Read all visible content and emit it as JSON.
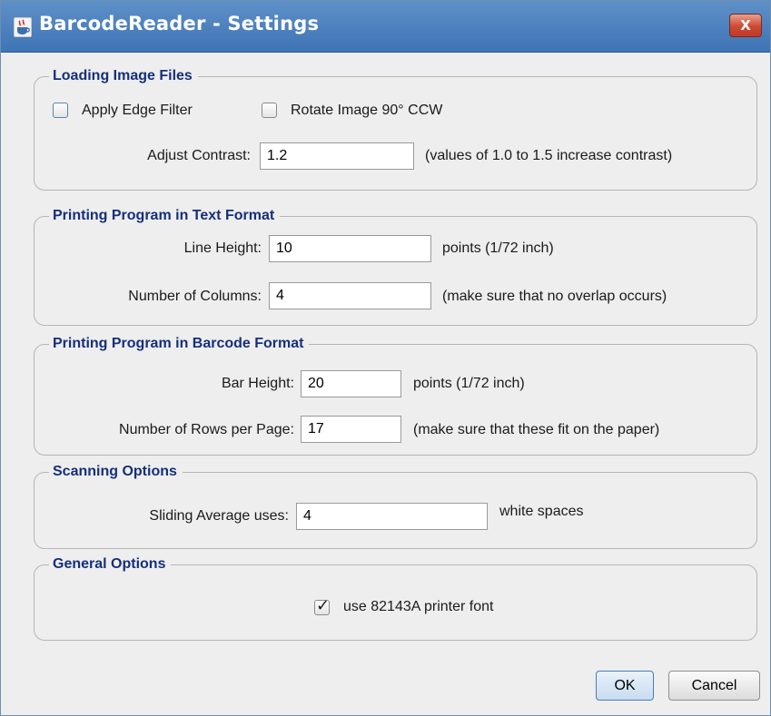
{
  "window": {
    "title": "BarcodeReader - Settings",
    "close_glyph": "X",
    "icon": "java-coffee-cup-icon"
  },
  "loading": {
    "title": "Loading Image Files",
    "apply_edge_filter": {
      "label": "Apply Edge Filter",
      "checked": false
    },
    "rotate_image": {
      "label": "Rotate Image 90° CCW",
      "checked": false
    },
    "contrast_label": "Adjust Contrast:",
    "contrast_value": "1.2",
    "contrast_hint": "(values of 1.0 to 1.5 increase contrast)"
  },
  "text_format": {
    "title": "Printing Program in Text Format",
    "line_height_label": "Line Height:",
    "line_height_value": "10",
    "line_height_unit": "points (1/72 inch)",
    "columns_label": "Number of Columns:",
    "columns_value": "4",
    "columns_hint": "(make sure that no overlap occurs)"
  },
  "barcode_format": {
    "title": "Printing Program in Barcode Format",
    "bar_height_label": "Bar Height:",
    "bar_height_value": "20",
    "bar_height_unit": "points (1/72 inch)",
    "rows_label": "Number of Rows per Page:",
    "rows_value": "17",
    "rows_hint": "(make sure that these fit on the paper)"
  },
  "scanning": {
    "title": "Scanning Options",
    "sliding_label": "Sliding Average uses:",
    "sliding_value": "4",
    "sliding_unit": "white spaces"
  },
  "general": {
    "title": "General Options",
    "printer_font": {
      "label": "use 82143A printer font",
      "checked": true,
      "mark": "✓"
    }
  },
  "buttons": {
    "ok": "OK",
    "cancel": "Cancel"
  },
  "colors": {
    "titlebar": "#4a7fbe",
    "group_title": "#162f7a",
    "close_button": "#c94a35"
  }
}
